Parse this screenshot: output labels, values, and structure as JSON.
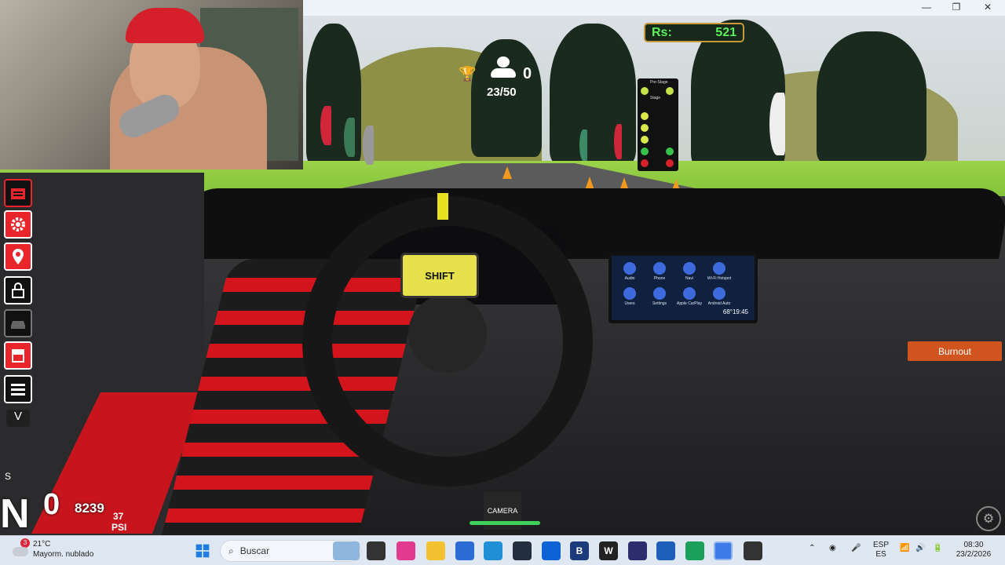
{
  "window": {
    "minimize": "—",
    "maximize": "❐",
    "close": "✕"
  },
  "hud": {
    "money_label": "Rs:",
    "money_value": "521",
    "players_count": "0",
    "laps": "23/50",
    "burnout_label": "Burnout",
    "gear": "N",
    "speed": "0",
    "rpm": "8239",
    "boost_value": "37",
    "boost_unit": "PSI",
    "camera_label": "CAMERA",
    "v_key": "V",
    "s_key": "S"
  },
  "sidebar_icons": [
    "garage-icon",
    "gear-icon",
    "map-pin-icon",
    "lock-icon",
    "car-icon",
    "shop-icon",
    "menu-icon"
  ],
  "car": {
    "shift_text": "SHIFT",
    "infotainment": {
      "apps": [
        "Audio",
        "Phone",
        "Navi",
        "Wi-Fi Hotspot",
        "Users",
        "Settings",
        "Apple CarPlay",
        "Android Auto"
      ],
      "clock": "68°19:45"
    },
    "tree_labels": {
      "prestage": "Pre-Stage",
      "stage": "Stage"
    }
  },
  "taskbar": {
    "weather_temp": "21°C",
    "weather_desc": "Mayorm. nublado",
    "weather_badge": "3",
    "search_placeholder": "Buscar",
    "lang_top": "ESP",
    "lang_bottom": "ES",
    "time": "08:30",
    "date": "23/2/2026"
  },
  "colors": {
    "accent_red": "#e8252a",
    "money_green": "#5bf05b",
    "burnout_orange": "#d0541e"
  }
}
